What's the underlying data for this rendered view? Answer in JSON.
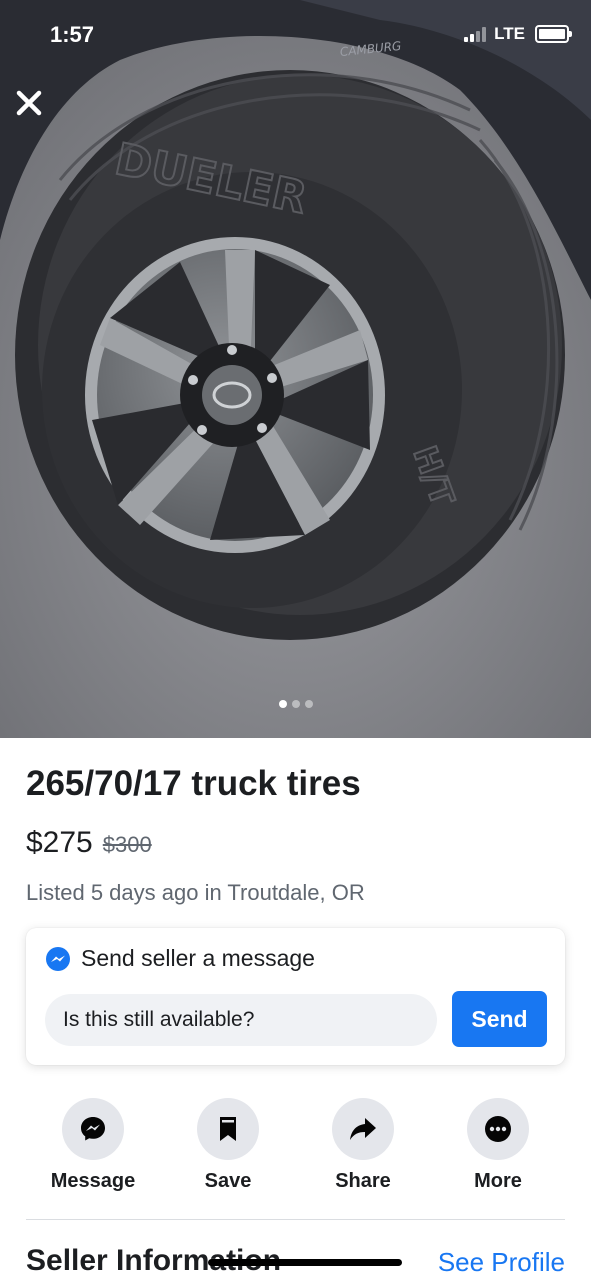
{
  "status_bar": {
    "time": "1:57",
    "network": "LTE"
  },
  "photo": {
    "icon": "close-icon",
    "tire_brand_text": "DUELER",
    "tire_model_text": "H/T",
    "vehicle_text": "CAMBURG",
    "carousel": {
      "total": 3,
      "active_index": 0
    }
  },
  "listing": {
    "title": "265/70/17 truck tires",
    "price": "$275",
    "original_price": "$300",
    "listed_text": "Listed 5 days ago in Troutdale, OR"
  },
  "message_card": {
    "icon": "messenger-icon",
    "heading": "Send seller a message",
    "input_value": "Is this still available?",
    "send_label": "Send"
  },
  "actions": [
    {
      "label": "Message",
      "icon": "messenger-icon"
    },
    {
      "label": "Save",
      "icon": "bookmark-icon"
    },
    {
      "label": "Share",
      "icon": "share-arrow-icon"
    },
    {
      "label": "More",
      "icon": "more-dots-icon"
    }
  ],
  "seller": {
    "title": "Seller Information",
    "link_label": "See Profile"
  },
  "colors": {
    "accent": "#1877f2",
    "action_bg": "#e4e6eb",
    "input_bg": "#f0f2f5"
  }
}
